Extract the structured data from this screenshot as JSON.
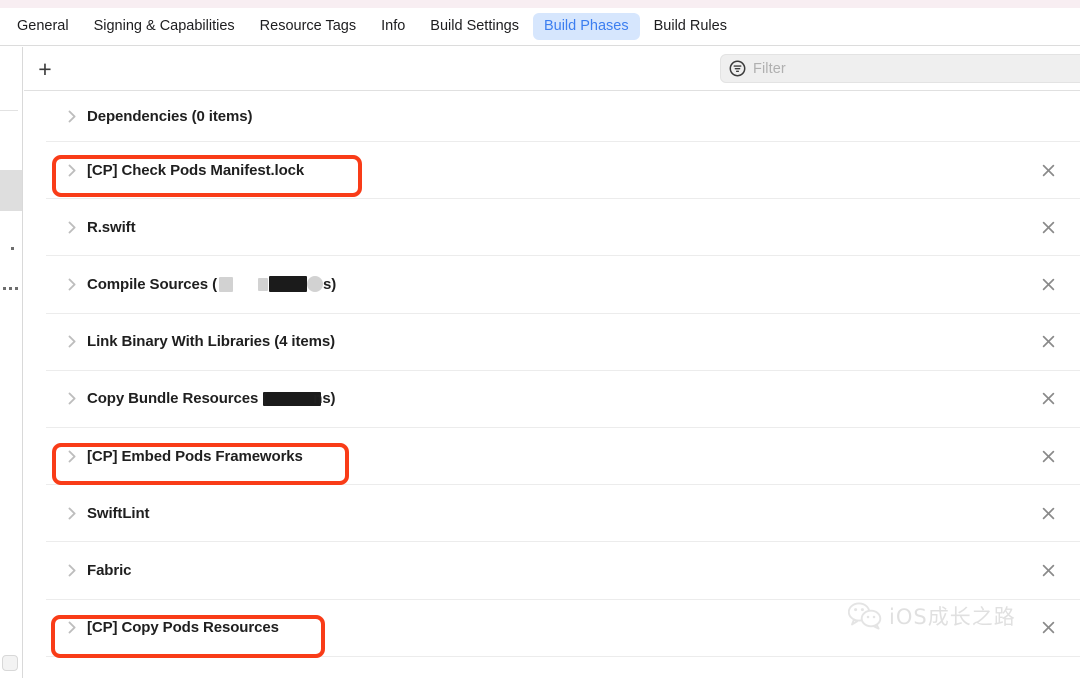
{
  "window": {
    "chrome_strip_color": "#f8eef2"
  },
  "tabbar": {
    "tabs": [
      {
        "label": "General",
        "active": false
      },
      {
        "label": "Signing & Capabilities",
        "active": false
      },
      {
        "label": "Resource Tags",
        "active": false
      },
      {
        "label": "Info",
        "active": false
      },
      {
        "label": "Build Settings",
        "active": false
      },
      {
        "label": "Build Phases",
        "active": true
      },
      {
        "label": "Build Rules",
        "active": false
      }
    ],
    "active_tab": "Build Phases",
    "active_tab_text_color": "#3c7ef0",
    "active_tab_bg_color": "#d6e6fd"
  },
  "toolbar": {
    "add_label": "+",
    "add_icon": "plus-icon",
    "filter_icon": "filter-icon",
    "filter_placeholder": "Filter",
    "filter_value": ""
  },
  "phases": {
    "disclosure_icon": "chevron-right-icon",
    "delete_icon": "close-icon",
    "rows": [
      {
        "label": "Dependencies (0 items)",
        "has_delete": false,
        "highlighted": false,
        "redacted": false
      },
      {
        "label": "[CP] Check Pods Manifest.lock",
        "has_delete": true,
        "highlighted": true,
        "redacted": false
      },
      {
        "label": "R.swift",
        "has_delete": true,
        "highlighted": false,
        "redacted": false
      },
      {
        "label": "Compile Sources (",
        "label_suffix": "s)",
        "has_delete": true,
        "highlighted": false,
        "redacted": true
      },
      {
        "label": "Link Binary With Libraries (4 items)",
        "has_delete": true,
        "highlighted": false,
        "redacted": false
      },
      {
        "label": "Copy Bundle Resources (",
        "label_suffix": "ns)",
        "has_delete": true,
        "highlighted": false,
        "redacted": true
      },
      {
        "label": "[CP] Embed Pods Frameworks",
        "has_delete": true,
        "highlighted": true,
        "redacted": false
      },
      {
        "label": "SwiftLint",
        "has_delete": true,
        "highlighted": false,
        "redacted": false
      },
      {
        "label": "Fabric",
        "has_delete": true,
        "highlighted": false,
        "redacted": false
      },
      {
        "label": "[CP] Copy Pods Resources",
        "has_delete": true,
        "highlighted": true,
        "redacted": false
      }
    ]
  },
  "annotations": {
    "color": "#f93c18",
    "boxes": [
      {
        "target": "[CP] Check Pods Manifest.lock"
      },
      {
        "target": "[CP] Embed Pods Frameworks"
      },
      {
        "target": "[CP] Copy Pods Resources"
      }
    ]
  },
  "watermark": {
    "logo_icon": "wechat-icon",
    "text": "iOS成长之路"
  }
}
